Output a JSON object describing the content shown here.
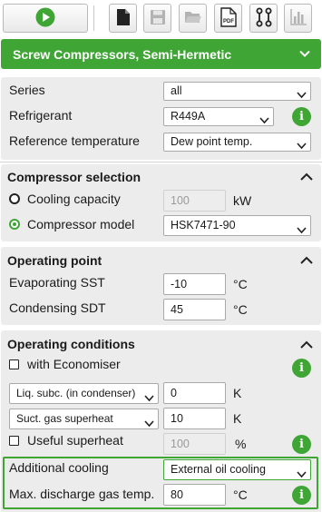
{
  "toolbar": {
    "buttons": [
      {
        "icon": "play-icon"
      },
      {
        "icon": "new-document-icon"
      },
      {
        "icon": "save-icon"
      },
      {
        "icon": "open-folder-icon"
      },
      {
        "icon": "pdf-icon",
        "label": "PDF"
      },
      {
        "icon": "compare-icon"
      },
      {
        "icon": "bar-chart-icon"
      }
    ]
  },
  "header": {
    "title": "Screw Compressors, Semi-Hermetic"
  },
  "general": {
    "series_label": "Series",
    "series_value": "all",
    "refrigerant_label": "Refrigerant",
    "refrigerant_value": "R449A",
    "reftemp_label": "Reference temperature",
    "reftemp_value": "Dew point temp."
  },
  "compressor_selection": {
    "title": "Compressor selection",
    "cooling_capacity_label": "Cooling capacity",
    "cooling_capacity_placeholder": "100",
    "cooling_capacity_unit": "kW",
    "model_label": "Compressor model",
    "model_value": "HSK7471-90"
  },
  "operating_point": {
    "title": "Operating point",
    "sst_label": "Evaporating SST",
    "sst_value": "-10",
    "sst_unit": "°C",
    "sdt_label": "Condensing SDT",
    "sdt_value": "45",
    "sdt_unit": "°C"
  },
  "operating_conditions": {
    "title": "Operating conditions",
    "economiser_label": "with Economiser",
    "liq_subc_option": "Liq. subc. (in condenser)",
    "liq_subc_value": "0",
    "liq_subc_unit": "K",
    "suct_option": "Suct. gas superheat",
    "suct_value": "10",
    "suct_unit": "K",
    "useful_label": "Useful superheat",
    "useful_placeholder": "100",
    "useful_unit": "%",
    "add_cooling_label": "Additional cooling",
    "add_cooling_value": "External oil cooling",
    "max_dgt_label": "Max. discharge gas temp.",
    "max_dgt_value": "80",
    "max_dgt_unit": "°C"
  },
  "info_symbol": "i",
  "colors": {
    "accent": "#3fa535",
    "panel": "#ececec"
  }
}
